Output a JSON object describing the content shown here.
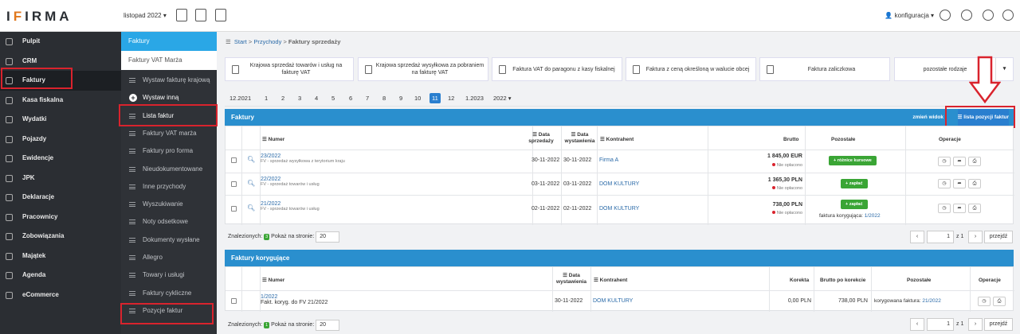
{
  "topbar": {
    "logo_left": "I",
    "logo_accent": "F",
    "logo_right": "IRMA",
    "period": "listopad 2022 ▾",
    "user": "konfiguracja ▾"
  },
  "sidebar": {
    "items": [
      {
        "label": "Pulpit",
        "icon": "dashboard-icon"
      },
      {
        "label": "CRM",
        "icon": "crm-icon"
      },
      {
        "label": "Faktury",
        "icon": "invoice-icon",
        "active": true
      },
      {
        "label": "Kasa fiskalna",
        "icon": "cash-register-icon"
      },
      {
        "label": "Wydatki",
        "icon": "expenses-icon"
      },
      {
        "label": "Pojazdy",
        "icon": "car-icon"
      },
      {
        "label": "Ewidencje",
        "icon": "records-icon"
      },
      {
        "label": "JPK",
        "icon": "jpk-icon"
      },
      {
        "label": "Deklaracje",
        "icon": "declarations-icon"
      },
      {
        "label": "Pracownicy",
        "icon": "employees-icon"
      },
      {
        "label": "Zobowiązania",
        "icon": "obligations-icon"
      },
      {
        "label": "Majątek",
        "icon": "assets-icon"
      },
      {
        "label": "Agenda",
        "icon": "agenda-icon"
      },
      {
        "label": "eCommerce",
        "icon": "cart-icon"
      }
    ]
  },
  "submenu": {
    "header": "Faktury",
    "vat_marza": "Faktury VAT Marża",
    "items": [
      "Wystaw fakturę krajową",
      "Wystaw inną",
      "Lista faktur",
      "Faktury VAT marża",
      "Faktury pro forma",
      "Nieudokumentowane",
      "Inne przychody",
      "Wyszukiwanie",
      "Noty odsetkowe",
      "Dokumenty wysłane",
      "Allegro",
      "Towary i usługi",
      "Faktury cykliczne",
      "Pozycje faktur"
    ]
  },
  "breadcrumb": {
    "start": "Start",
    "sep": ">",
    "przychody": "Przychody",
    "current": "Faktury sprzedaży"
  },
  "cards": [
    "Krajowa sprzedaż towarów i usług na fakturę VAT",
    "Krajowa sprzedaż wysyłkowa za pobraniem na fakturę VAT",
    "Faktura VAT do paragonu z kasy fiskalnej",
    "Faktura z ceną określoną w walucie obcej",
    "Faktura zaliczkowa",
    "pozostałe rodzaje"
  ],
  "months": [
    "12.2021",
    "1",
    "2",
    "3",
    "4",
    "5",
    "6",
    "7",
    "8",
    "9",
    "10",
    "11",
    "12",
    "1.2023",
    "2022 ▾"
  ],
  "faktury": {
    "title": "Faktury",
    "zmien_widok": "zmień widok",
    "lista_pozycji": "lista pozycji faktur",
    "headers": {
      "numer": "Numer",
      "data_sprz": "Data sprzedaży",
      "data_wyst": "Data wystawienia",
      "kontrahent": "Kontrahent",
      "brutto": "Brutto",
      "pozostale": "Pozostałe",
      "operacje": "Operacje"
    },
    "rows": [
      {
        "numer": "23/2022",
        "opis": "FV - sprzedaż wysyłkowa z terytorium kraju",
        "data_sprz": "30-11-2022",
        "data_wyst": "30-11-2022",
        "kontrahent": "Firma A",
        "brutto": "1 845,00 EUR",
        "status": "Nie opłacono",
        "button": "+ różnice kursowe",
        "extra": "",
        "extra_link": ""
      },
      {
        "numer": "22/2022",
        "opis": "FV - sprzedaż towarów i usług",
        "data_sprz": "03-11-2022",
        "data_wyst": "03-11-2022",
        "kontrahent": "DOM KULTURY",
        "brutto": "1 365,30 PLN",
        "status": "Nie opłacono",
        "button": "+ zapłać",
        "extra": "",
        "extra_link": ""
      },
      {
        "numer": "21/2022",
        "opis": "FV - sprzedaż towarów i usług",
        "data_sprz": "02-11-2022",
        "data_wyst": "02-11-2022",
        "kontrahent": "DOM KULTURY",
        "brutto": "738,00 PLN",
        "status": "Nie opłacono",
        "button": "+ zapłać",
        "extra": "faktura korygująca:",
        "extra_link": "1/2022"
      }
    ],
    "found_label": "Znalezionych:",
    "found_count": "3",
    "per_page_label": "Pokaż na stronie:",
    "per_page": "20",
    "page": "1",
    "of": "z 1",
    "next": "przejdź"
  },
  "korygujace": {
    "title": "Faktury korygujące",
    "headers": {
      "numer": "Numer",
      "data_wyst": "Data wystawienia",
      "kontrahent": "Kontrahent",
      "korekta": "Korekta",
      "brutto_po": "Brutto po korekcie",
      "pozostale": "Pozostałe",
      "operacje": "Operacje"
    },
    "row": {
      "numer": "1/2022",
      "opis": "Fakt. koryg. do FV 21/2022",
      "data_wyst": "30-11-2022",
      "kontrahent": "DOM KULTURY",
      "korekta": "0,00 PLN",
      "brutto_po": "738,00 PLN",
      "extra": "korygowana faktura:",
      "extra_link": "21/2022"
    },
    "found_label": "Znalezionych:",
    "found_count": "1",
    "per_page_label": "Pokaż na stronie:",
    "per_page": "20",
    "page": "1",
    "of": "z 1",
    "next": "przejdź"
  }
}
